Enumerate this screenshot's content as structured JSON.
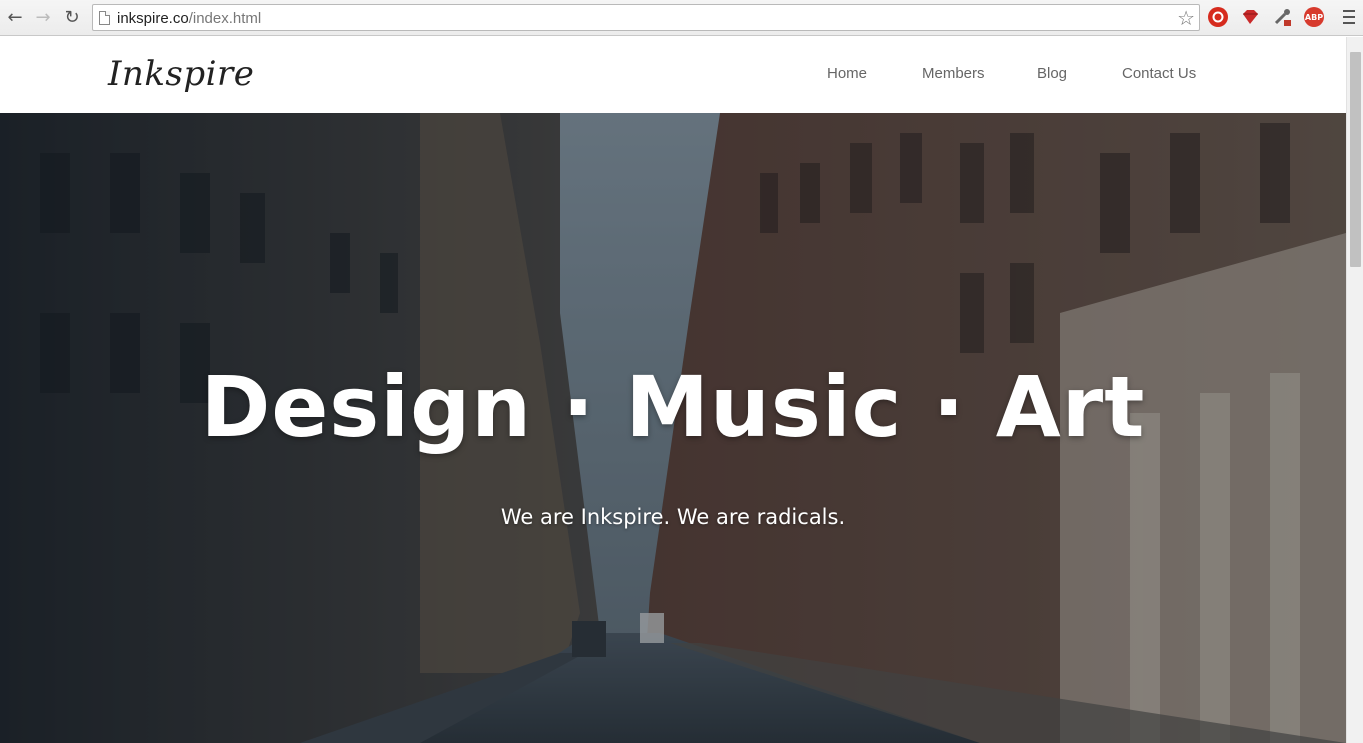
{
  "browser": {
    "url_host": "inkspire.co",
    "url_path": "/index.html",
    "extensions": [
      {
        "name": "stop-sign-extension-icon",
        "color": "#d62b1e",
        "label": ""
      },
      {
        "name": "red-gem-extension-icon",
        "color": "#c92a2a",
        "label": ""
      },
      {
        "name": "eyedropper-extension-icon",
        "color": "#777777",
        "label": ""
      },
      {
        "name": "adblock-plus-icon",
        "color": "#d73a2d",
        "label": "ABP"
      }
    ]
  },
  "site": {
    "logo": "Inkspire",
    "nav": [
      {
        "label": "Home"
      },
      {
        "label": "Members"
      },
      {
        "label": "Blog"
      },
      {
        "label": "Contact Us"
      }
    ]
  },
  "hero": {
    "title": "Design · Music · Art",
    "subtitle": "We are Inkspire. We are radicals.",
    "overlay_color": "#1d2730"
  }
}
